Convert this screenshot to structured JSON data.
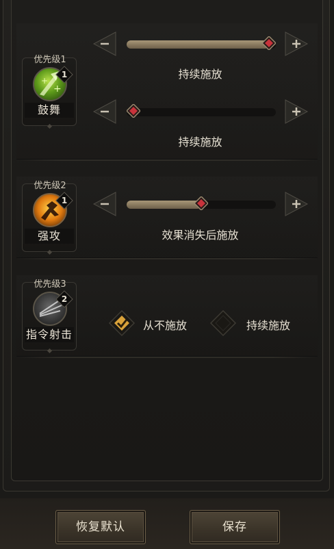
{
  "rows": [
    {
      "priority": "优先级1",
      "skill_name": "鼓舞",
      "count": "1",
      "sliders": [
        {
          "level": 1.0,
          "label": "持续施放"
        },
        {
          "level": 0.0,
          "label": "持续施放"
        }
      ]
    },
    {
      "priority": "优先级2",
      "skill_name": "强攻",
      "count": "1",
      "sliders": [
        {
          "level": 0.5,
          "label": "效果消失后施放"
        }
      ]
    },
    {
      "priority": "优先级3",
      "skill_name": "指令射击",
      "count": "2",
      "options": [
        {
          "label": "从不施放",
          "checked": true
        },
        {
          "label": "持续施放",
          "checked": false
        }
      ]
    }
  ],
  "buttons": {
    "restore_default": "恢复默认",
    "save": "保存"
  },
  "colors": {
    "accent_gold": "#d9a23a",
    "knob_red": "#c8333b",
    "track_fill": "#a89777"
  },
  "icons": {
    "minus": "minus-icon",
    "plus": "plus-icon",
    "knob": "diamond-knob-icon",
    "check": "check-icon"
  }
}
